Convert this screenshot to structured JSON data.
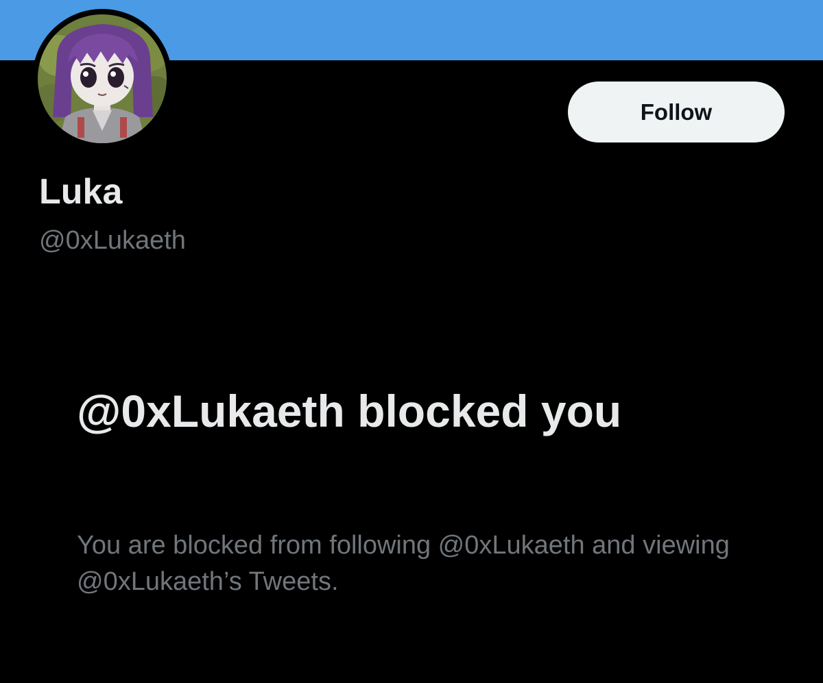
{
  "profile": {
    "display_name": "Luka",
    "handle": "@0xLukaeth"
  },
  "actions": {
    "follow_label": "Follow"
  },
  "blocked": {
    "title": "@0xLukaeth blocked you",
    "description": "You are blocked from following @0xLukaeth and viewing @0xLukaeth’s Tweets."
  },
  "colors": {
    "banner": "#4A9AE5",
    "background": "#000000",
    "primary_text": "#E7E9EA",
    "secondary_text": "#71767B",
    "follow_button_bg": "#EFF3F4"
  },
  "icons": {
    "avatar": "anime-girl-purple-hair-avatar"
  }
}
